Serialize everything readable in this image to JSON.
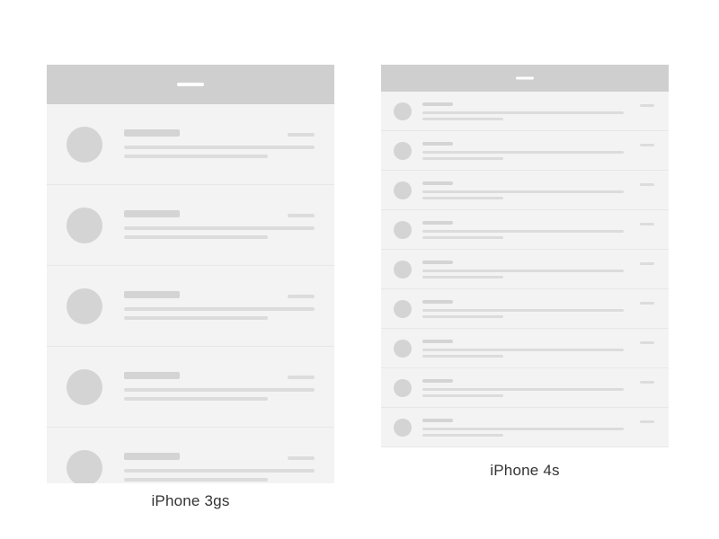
{
  "diagram": {
    "left": {
      "caption": "iPhone 3gs",
      "row_count": 5
    },
    "right": {
      "caption": "iPhone 4s",
      "row_count": 9
    }
  }
}
